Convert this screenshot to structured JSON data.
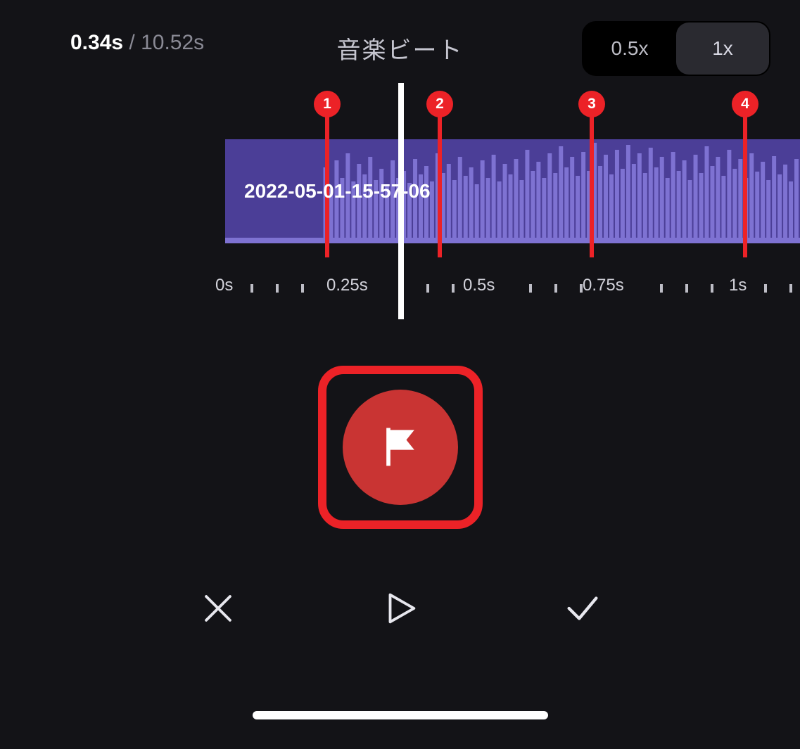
{
  "header": {
    "current_time": "0.34s",
    "separator": " / ",
    "total_time": "10.52s",
    "title": "音楽ビート",
    "speed_options": [
      "0.5x",
      "1x"
    ],
    "speed_selected_index": 1
  },
  "clip": {
    "label": "2022-05-01-15-57-06"
  },
  "markers": [
    {
      "n": "1"
    },
    {
      "n": "2"
    },
    {
      "n": "3"
    },
    {
      "n": "4"
    }
  ],
  "ruler": {
    "labels": [
      "0s",
      "0.25s",
      "0.5s",
      "0.75s",
      "1s"
    ]
  },
  "icons": {
    "flag": "flag-icon",
    "cancel": "close-icon",
    "play": "play-icon",
    "confirm": "check-icon"
  }
}
